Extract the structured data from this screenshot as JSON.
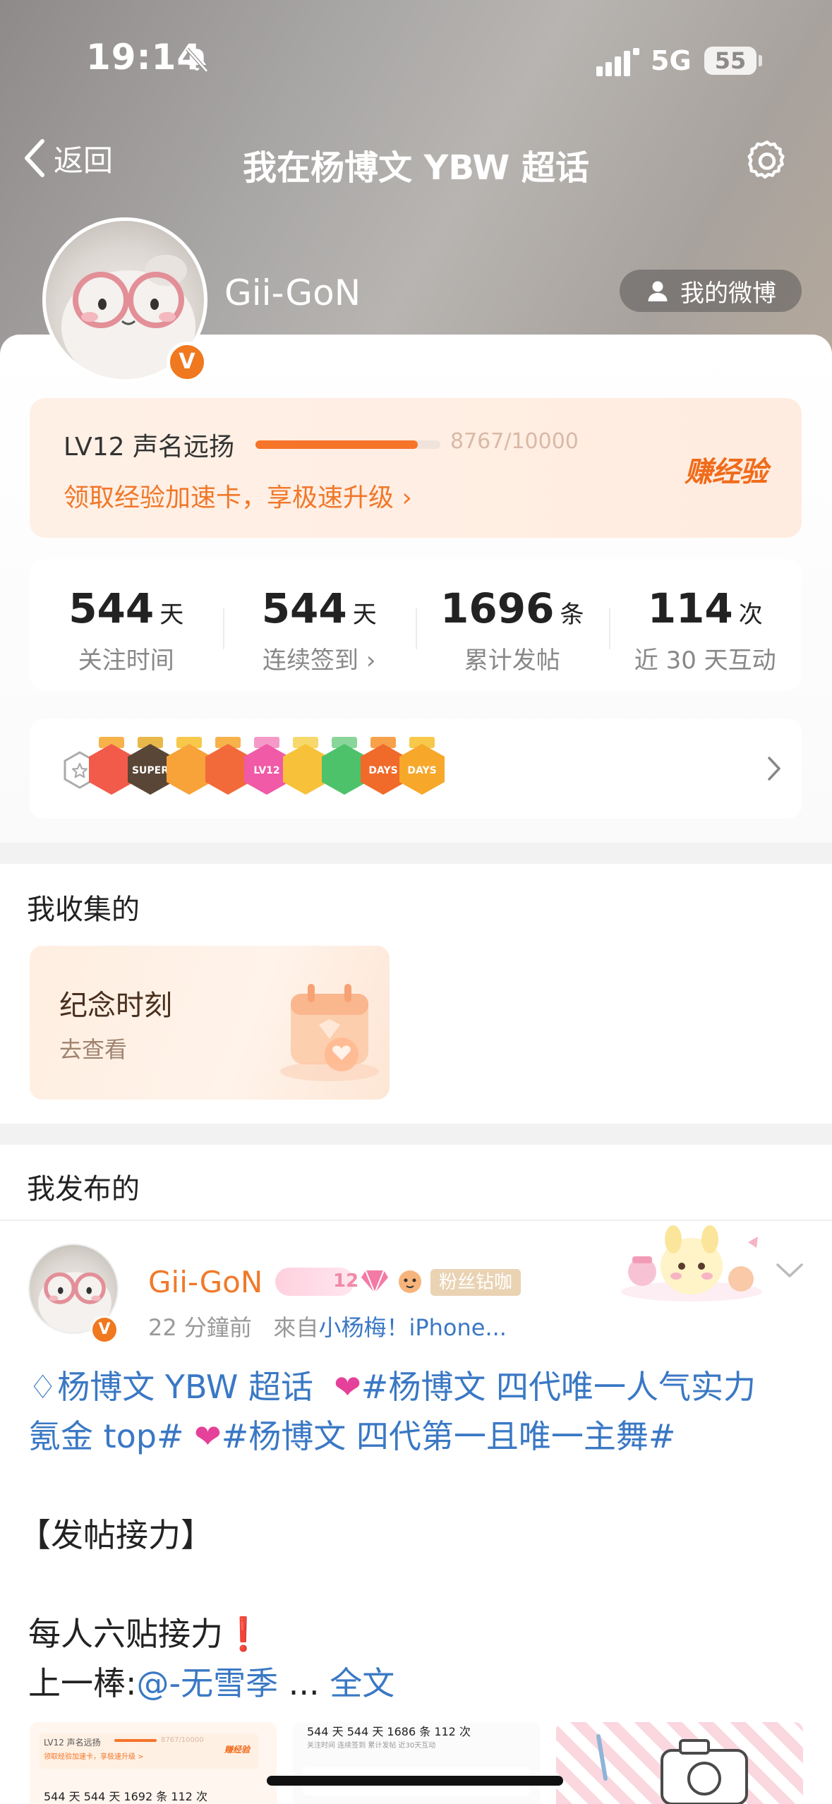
{
  "status_bar": {
    "time": "19:14",
    "network": "5G",
    "battery": "55"
  },
  "nav": {
    "back_label": "返回",
    "title": "我在杨博文 YBW 超话"
  },
  "profile": {
    "username": "Gii-GoN",
    "my_weibo_label": "我的微博",
    "verified_glyph": "V"
  },
  "level": {
    "title": "LV12 声名远扬",
    "progress_text": "8767/10000",
    "progress_fraction": 0.8767,
    "boost_text": "领取经验加速卡，享极速升级 ›",
    "earn_label": "赚经验"
  },
  "stats": [
    {
      "value": "544",
      "unit": "天",
      "label": "关注时间"
    },
    {
      "value": "544",
      "unit": "天",
      "label": "连续签到 ›"
    },
    {
      "value": "1696",
      "unit": "条",
      "label": "累计发帖"
    },
    {
      "value": "114",
      "unit": "次",
      "label": "近 30 天互动"
    }
  ],
  "medals": [
    {
      "name": "bear-medal",
      "text": "",
      "color": "#f25a4a",
      "ribbon": "#f7b24a"
    },
    {
      "name": "super-medal",
      "text": "SUPER",
      "color": "#5a4636",
      "ribbon": "#e9b84a"
    },
    {
      "name": "crown-medal",
      "text": "",
      "color": "#f7a33a",
      "ribbon": "#f7c84a"
    },
    {
      "name": "fire-medal",
      "text": "",
      "color": "#f26a3a",
      "ribbon": "#f7b24a"
    },
    {
      "name": "lv12-medal",
      "text": "LV12",
      "color": "#f05aa6",
      "ribbon": "#f59ac8"
    },
    {
      "name": "star-medal",
      "text": "",
      "color": "#f7c23a",
      "ribbon": "#f7d86a"
    },
    {
      "name": "hand-medal",
      "text": "",
      "color": "#4ec26a",
      "ribbon": "#8ad69a"
    },
    {
      "name": "100-days-medal",
      "text": "DAYS",
      "color": "#f06a2a",
      "ribbon": "#f7a24a"
    },
    {
      "name": "30-days-medal",
      "text": "DAYS",
      "color": "#f7a82a",
      "ribbon": "#f7c84a"
    }
  ],
  "collected": {
    "section_title": "我收集的",
    "card_title": "纪念时刻",
    "card_link": "去查看"
  },
  "posted": {
    "section_title": "我发布的",
    "post": {
      "username": "Gii-GoN",
      "badge_number": "12",
      "fan_tag": "粉丝钻咖",
      "time": "22 分鐘前",
      "from_prefix": "來自",
      "source": "小杨梅！iPhone...",
      "line1_topic": "杨博文 YBW 超话",
      "line1_tag": "#杨博文 四代唯一人气实力",
      "line2_tag_a": "氪金 top#",
      "line2_tag_b": "#杨博文 四代第一且唯一主舞#",
      "line3": "【发帖接力】",
      "line4": "每人六贴接力",
      "line5_prefix": "上一棒:",
      "line5_mention": "@-无雪季",
      "line5_ellipsis": " ... ",
      "line5_more": "全文",
      "thumb1_title": "LV12 声名远扬",
      "thumb1_progress": "8767/10000",
      "thumb1_boost": "领取经验加速卡，享极速升级 >",
      "thumb1_earn": "赚经验",
      "thumb1_stats": "544 天   544 天   1692 条   112 次",
      "thumb2_stats": "544 天   544 天   1686 条   112 次",
      "thumb2_labels": "关注时间  连续签到  累计发帖  近30天互动"
    }
  },
  "colors": {
    "accent": "#f0782a",
    "link": "#3a78c4",
    "heart": "#e5409a"
  }
}
